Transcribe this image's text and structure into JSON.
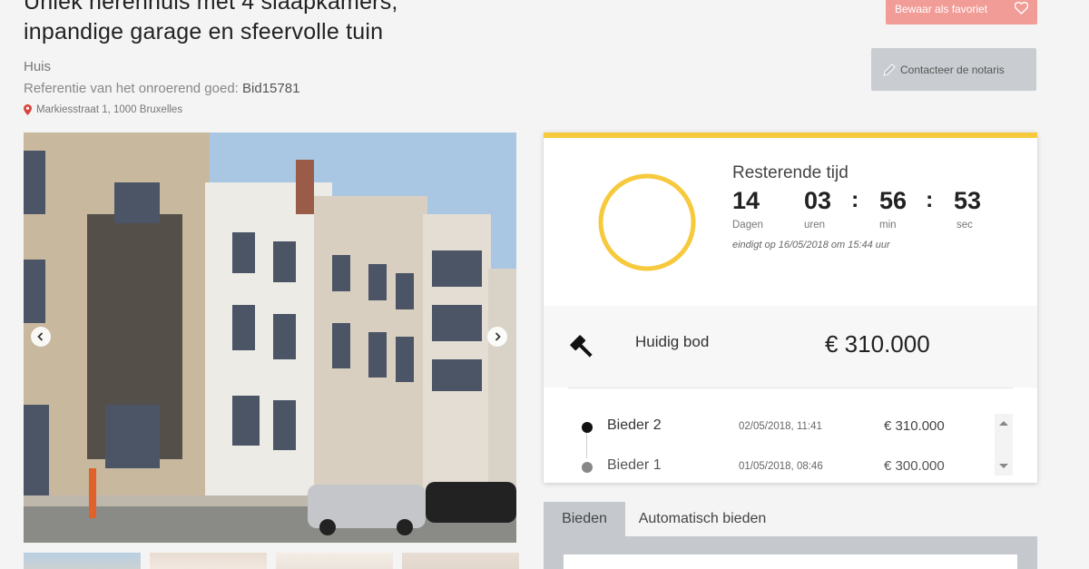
{
  "listing": {
    "title_line1": "Uniek herenhuis met 4 slaapkamers,",
    "title_line2": "inpandige garage en sfeervolle tuin",
    "type": "Huis",
    "ref_label": "Referentie van het onroerend goed:",
    "ref_value": "Bid15781",
    "address": "Markiesstraat 1, 1000 Bruxelles",
    "pin_icon": "location-pin-icon"
  },
  "actions": {
    "favorite_label": "Bewaar als favoriet",
    "favorite_icon": "heart-icon",
    "notary_label": "Contacteer de notaris",
    "notary_icon": "pen-icon"
  },
  "colors": {
    "accent": "#f7c93c",
    "favorite_bg": "#f19c97",
    "notary_bg": "#c9cdd1"
  },
  "countdown": {
    "label": "Resterende tijd",
    "days": "14",
    "hours": "03",
    "minutes": "56",
    "seconds": "53",
    "days_unit": "Dagen",
    "hours_unit": "uren",
    "minutes_unit": "min",
    "seconds_unit": "sec",
    "ends": "eindigt op 16/05/2018 om 15:44 uur"
  },
  "current_bid": {
    "label": "Huidig bod",
    "value": "€ 310.000",
    "icon": "gavel-icon"
  },
  "bids": [
    {
      "name": "Bieder 2",
      "date": "02/05/2018, 11:41",
      "value": "€ 310.000",
      "color": "#111111"
    },
    {
      "name": "Bieder 1",
      "date": "01/05/2018, 08:46",
      "value": "€ 300.000",
      "color": "#888888"
    }
  ],
  "tabs": {
    "bid": "Bieden",
    "auto": "Automatisch bieden"
  }
}
